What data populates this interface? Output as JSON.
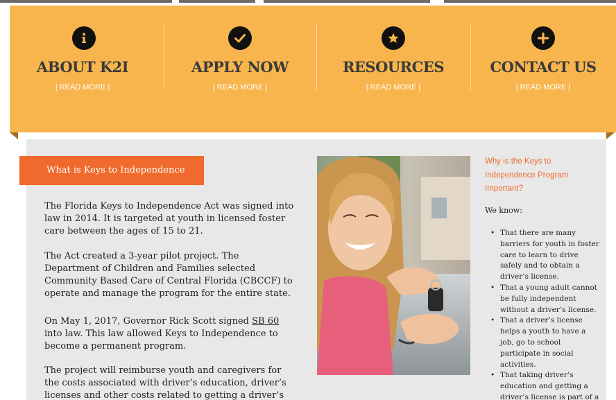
{
  "nav": {
    "items": [
      {
        "title": "ABOUT K2I",
        "more": "| READ MORE |",
        "icon": "info-icon"
      },
      {
        "title": "APPLY NOW",
        "more": "| READ MORE |",
        "icon": "checkmark-icon"
      },
      {
        "title": "RESOURCES",
        "more": "| READ MORE |",
        "icon": "star-icon"
      },
      {
        "title": "CONTACT US",
        "more": "| READ MORE |",
        "icon": "plus-icon"
      }
    ],
    "band_color": "#f8b54d"
  },
  "main": {
    "heading": "What is Keys to Independence",
    "paragraphs": [
      "The Florida Keys to Independence Act was signed into law in 2014.  It is targeted at youth in licensed foster care between the ages of 15 to 21.",
      "The Act created a 3-year pilot project.  The Department of Children and Families  selected  Community Based Care of Central Florida (CBCCF) to operate and manage the program for the entire state.",
      "The project will reimburse youth and caregivers for the costs associated with driver’s education, driver’s licenses and other costs related to getting a driver’s"
    ],
    "para3": {
      "before": "On May 1, 2017, Governor Rick Scott signed ",
      "link": "SB 60 ",
      "after": "into law. This law allowed Keys to Independence to become a permanent program."
    },
    "accent_color": "#ef6a2c",
    "photo_alt": "Smiling teen girl holding car keys"
  },
  "sidebar": {
    "title": "Why is the Keys to Independence Program Important?",
    "intro": "We know:",
    "items": [
      "That there are many barriers for youth in foster care to learn to drive safely and to obtain a driver’s license.",
      "That a young adult cannot be fully independent without a driver’s license.",
      "That a driver’s license helps a youth to have a job, go to school participate in social activities.",
      "That taking driver’s education and getting a driver’s license is part of a normal teen’s life."
    ]
  }
}
